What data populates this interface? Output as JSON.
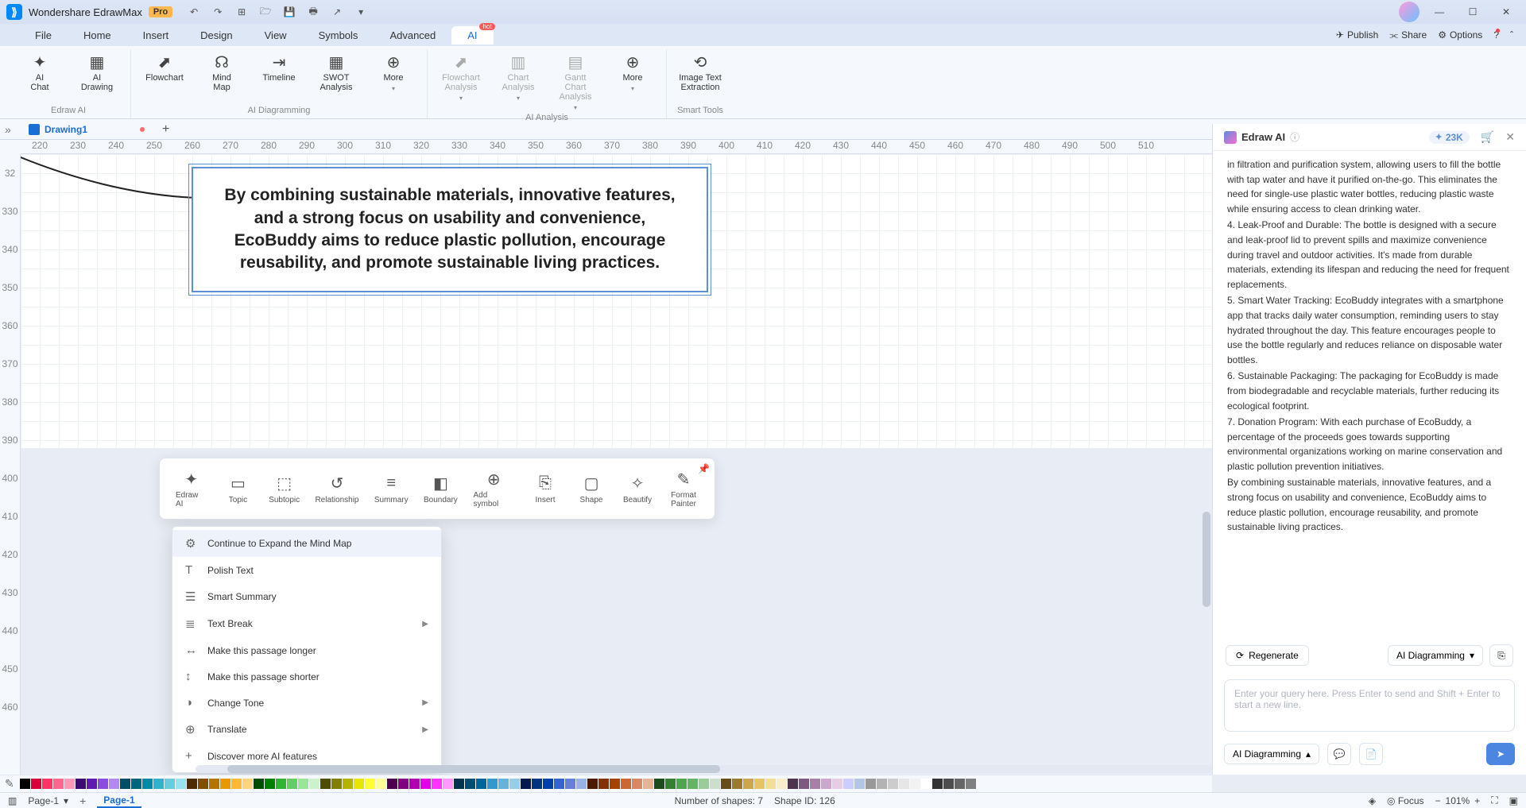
{
  "app": {
    "name": "Wondershare EdrawMax",
    "badge": "Pro"
  },
  "window": {
    "min": "—",
    "max": "☐",
    "close": "✕"
  },
  "menu": {
    "items": [
      "File",
      "Home",
      "Insert",
      "Design",
      "View",
      "Symbols",
      "Advanced",
      "AI"
    ],
    "hot": "hot",
    "right": {
      "publish": "Publish",
      "share": "Share",
      "options": "Options"
    }
  },
  "ribbon": {
    "groups": [
      {
        "label": "Edraw AI",
        "items": [
          {
            "lbl": "AI\nChat",
            "ico": "✦"
          },
          {
            "lbl": "AI\nDrawing",
            "ico": "▦"
          }
        ]
      },
      {
        "label": "AI Diagramming",
        "items": [
          {
            "lbl": "Flowchart",
            "ico": "⬈"
          },
          {
            "lbl": "Mind\nMap",
            "ico": "☊"
          },
          {
            "lbl": "Timeline",
            "ico": "⇥"
          },
          {
            "lbl": "SWOT\nAnalysis",
            "ico": "▦"
          },
          {
            "lbl": "More",
            "ico": "⊕",
            "car": true
          }
        ]
      },
      {
        "label": "AI Analysis",
        "items": [
          {
            "lbl": "Flowchart\nAnalysis",
            "ico": "⬈",
            "dim": true,
            "car": true
          },
          {
            "lbl": "Chart\nAnalysis",
            "ico": "▥",
            "dim": true,
            "car": true
          },
          {
            "lbl": "Gantt Chart\nAnalysis",
            "ico": "▤",
            "dim": true,
            "car": true
          },
          {
            "lbl": "More",
            "ico": "⊕",
            "car": true
          }
        ]
      },
      {
        "label": "Smart Tools",
        "items": [
          {
            "lbl": "Image Text\nExtraction",
            "ico": "⟲"
          }
        ]
      }
    ]
  },
  "tabs": {
    "doc": "Drawing1",
    "add": "+"
  },
  "ruler_h": [
    "220",
    "230",
    "240",
    "250",
    "260",
    "270",
    "280",
    "290",
    "300",
    "310",
    "320",
    "330",
    "340",
    "350",
    "360",
    "370",
    "380",
    "390",
    "400",
    "410",
    "420",
    "430",
    "440",
    "450",
    "460",
    "470",
    "480",
    "490",
    "500",
    "510"
  ],
  "ruler_v": [
    "32",
    "330",
    "340",
    "350",
    "360",
    "370",
    "380",
    "390",
    "400",
    "410",
    "420",
    "430",
    "440",
    "450",
    "460"
  ],
  "shape_text": "By combining sustainable materials, innovative features, and a strong focus on usability and convenience, EcoBuddy aims to reduce plastic pollution, encourage reusability, and promote sustainable living practices.",
  "float_toolbar": [
    {
      "lbl": "Edraw AI",
      "ico": "✦"
    },
    {
      "lbl": "Topic",
      "ico": "▭"
    },
    {
      "lbl": "Subtopic",
      "ico": "⬚"
    },
    {
      "lbl": "Relationship",
      "ico": "↺"
    },
    {
      "lbl": "Summary",
      "ico": "≡"
    },
    {
      "lbl": "Boundary",
      "ico": "◧"
    },
    {
      "lbl": "Add symbol",
      "ico": "⊕"
    },
    {
      "lbl": "Insert",
      "ico": "⎘"
    },
    {
      "lbl": "Shape",
      "ico": "▢"
    },
    {
      "lbl": "Beautify",
      "ico": "✧"
    },
    {
      "lbl": "Format\nPainter",
      "ico": "✎"
    }
  ],
  "ai_menu": [
    {
      "lbl": "Continue to Expand the Mind Map",
      "ico": "⚙",
      "hl": true
    },
    {
      "lbl": "Polish Text",
      "ico": "T"
    },
    {
      "lbl": "Smart Summary",
      "ico": "☰"
    },
    {
      "lbl": "Text Break",
      "ico": "≣",
      "sub": true
    },
    {
      "lbl": "Make this passage longer",
      "ico": "↔"
    },
    {
      "lbl": "Make this passage shorter",
      "ico": "↕"
    },
    {
      "lbl": "Change Tone",
      "ico": "◑",
      "sub": true
    },
    {
      "lbl": "Translate",
      "ico": "⊕",
      "sub": true
    },
    {
      "lbl": "Discover more AI features",
      "ico": "+"
    }
  ],
  "right": {
    "title": "Edraw AI",
    "credits": "23K",
    "content": [
      "in filtration and purification system, allowing users to fill the bottle with tap water and have it purified on-the-go. This eliminates the need for single-use plastic water bottles, reducing plastic waste while ensuring access to clean drinking water.",
      "4. Leak-Proof and Durable: The bottle is designed with a secure and leak-proof lid to prevent spills and maximize convenience during travel and outdoor activities. It's made from durable materials, extending its lifespan and reducing the need for frequent replacements.",
      "5. Smart Water Tracking: EcoBuddy integrates with a smartphone app that tracks daily water consumption, reminding users to stay hydrated throughout the day. This feature encourages people to use the bottle regularly and reduces reliance on disposable water bottles.",
      "6. Sustainable Packaging: The packaging for EcoBuddy is made from biodegradable and recyclable materials, further reducing its ecological footprint.",
      "7. Donation Program: With each purchase of EcoBuddy, a percentage of the proceeds goes towards supporting environmental organizations working on marine conservation and plastic pollution prevention initiatives.",
      "By combining sustainable materials, innovative features, and a strong focus on usability and convenience, EcoBuddy aims to reduce plastic pollution, encourage reusability, and promote sustainable living practices."
    ],
    "regen": "Regenerate",
    "mode": "AI Diagramming",
    "placeholder": "Enter your query here. Press Enter to send and Shift + Enter to start a new line.",
    "bottom_mode": "AI Diagramming"
  },
  "palette": [
    "#000000",
    "#d9003a",
    "#ff3366",
    "#ff668f",
    "#ff99b7",
    "#3d0a73",
    "#5e1bb0",
    "#8a4de0",
    "#b388ef",
    "#004d66",
    "#006680",
    "#008aa6",
    "#33b0cc",
    "#66cde0",
    "#99e3ef",
    "#4d2c00",
    "#805000",
    "#b37400",
    "#e69900",
    "#ffb833",
    "#ffd480",
    "#004d00",
    "#008000",
    "#33b333",
    "#66cc66",
    "#99e699",
    "#ccf2cc",
    "#4d4d00",
    "#808000",
    "#b3b300",
    "#e6e600",
    "#ffff33",
    "#ffff99",
    "#4d004d",
    "#800080",
    "#b300b3",
    "#e600e6",
    "#ff33ff",
    "#ff99ff",
    "#00334d",
    "#004d73",
    "#006699",
    "#3399cc",
    "#66b3d9",
    "#99cce6",
    "#001a4d",
    "#003380",
    "#0040a6",
    "#3366cc",
    "#6680d9",
    "#99b3e6",
    "#4d1a00",
    "#803300",
    "#a64200",
    "#cc6633",
    "#d98866",
    "#e6b399",
    "#1a4d1a",
    "#338033",
    "#4da64d",
    "#66b366",
    "#99cc99",
    "#ccdfcc",
    "#664d1a",
    "#997a33",
    "#cca64d",
    "#e6c466",
    "#f2dd99",
    "#f9eecc",
    "#4d334d",
    "#805980",
    "#a680a6",
    "#cca6cc",
    "#e6cce6",
    "#ccccff",
    "#b3c6e6",
    "#999999",
    "#b3b3b3",
    "#cccccc",
    "#e6e6e6",
    "#f2f2f2",
    "#ffffff",
    "#333333",
    "#4d4d4d",
    "#666666",
    "#808080"
  ],
  "status": {
    "page_sel": "Page-1",
    "page_btn": "Page-1",
    "shapes": "Number of shapes: 7",
    "shape_id": "Shape ID: 126",
    "focus": "Focus",
    "zoom": "101%"
  }
}
